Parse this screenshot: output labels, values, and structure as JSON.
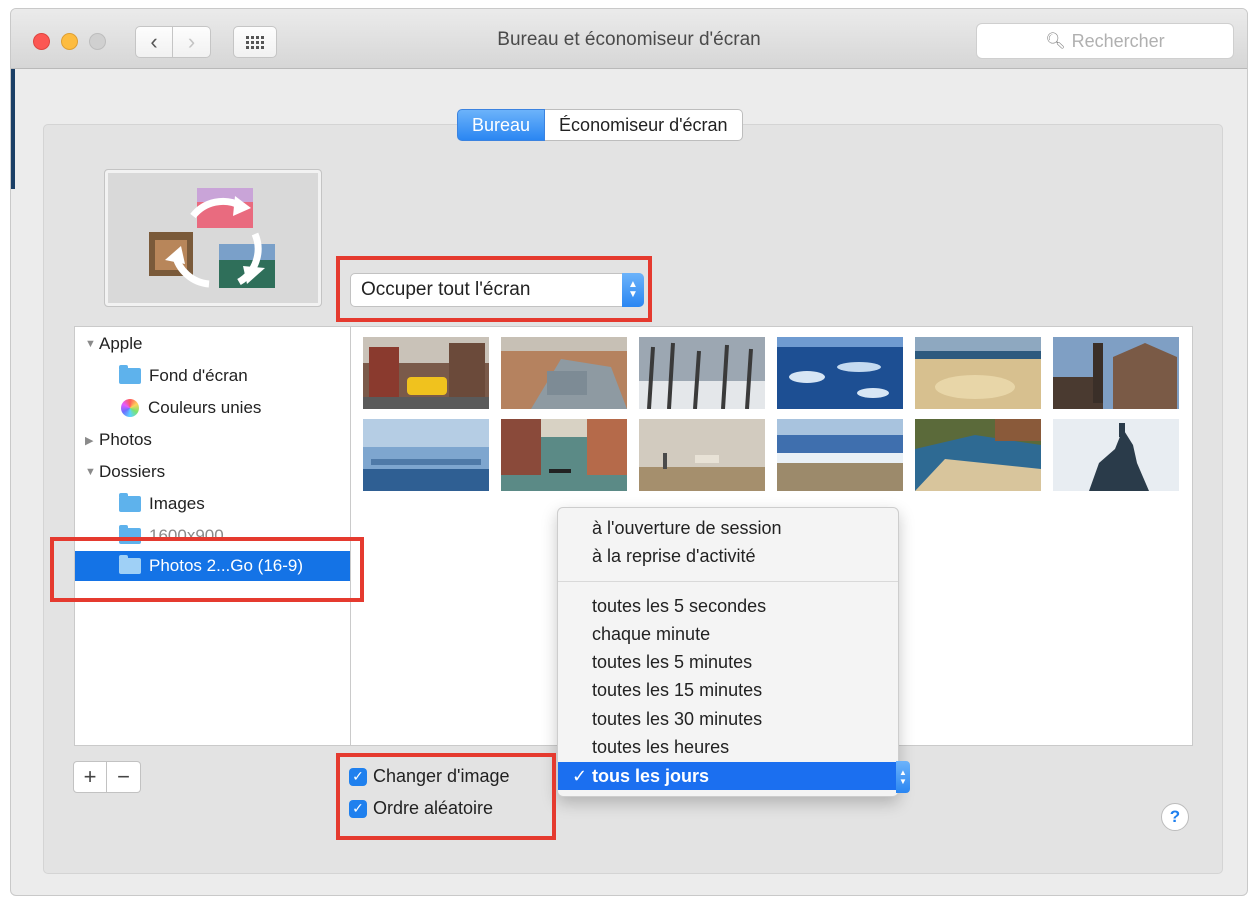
{
  "window": {
    "title": "Bureau et économiseur d'écran",
    "search_placeholder": "Rechercher"
  },
  "tabs": [
    {
      "label": "Bureau",
      "active": true
    },
    {
      "label": "Économiseur d'écran",
      "active": false
    }
  ],
  "fit_popup": {
    "value": "Occuper tout l'écran"
  },
  "sidebar": {
    "groups": [
      {
        "label": "Apple",
        "expanded": true,
        "items": [
          {
            "label": "Fond d'écran",
            "icon": "folder-icon"
          },
          {
            "label": "Couleurs unies",
            "icon": "color-wheel-icon"
          }
        ]
      },
      {
        "label": "Photos",
        "expanded": false,
        "items": []
      },
      {
        "label": "Dossiers",
        "expanded": true,
        "items": [
          {
            "label": "Images",
            "icon": "folder-icon"
          },
          {
            "label": "1600x900",
            "icon": "folder-icon"
          },
          {
            "label": "Photos 2...Go (16-9)",
            "icon": "folder-icon",
            "selected": true
          }
        ]
      }
    ]
  },
  "checkboxes": {
    "change_picture": {
      "label": "Changer d'image",
      "checked": true
    },
    "random_order": {
      "label": "Ordre aléatoire",
      "checked": true
    }
  },
  "interval_menu": {
    "group1": [
      "à l'ouverture de session",
      "à la reprise d'activité"
    ],
    "group2": [
      "toutes les 5 secondes",
      "chaque minute",
      "toutes les 5 minutes",
      "toutes les 15 minutes",
      "toutes les 30 minutes",
      "toutes les heures"
    ],
    "selected": "tous les jours"
  },
  "buttons": {
    "add": "+",
    "remove": "−",
    "help": "?"
  },
  "colors": {
    "accent": "#1f80ee",
    "highlight": "#e53a2f",
    "selection": "#1473e6"
  }
}
